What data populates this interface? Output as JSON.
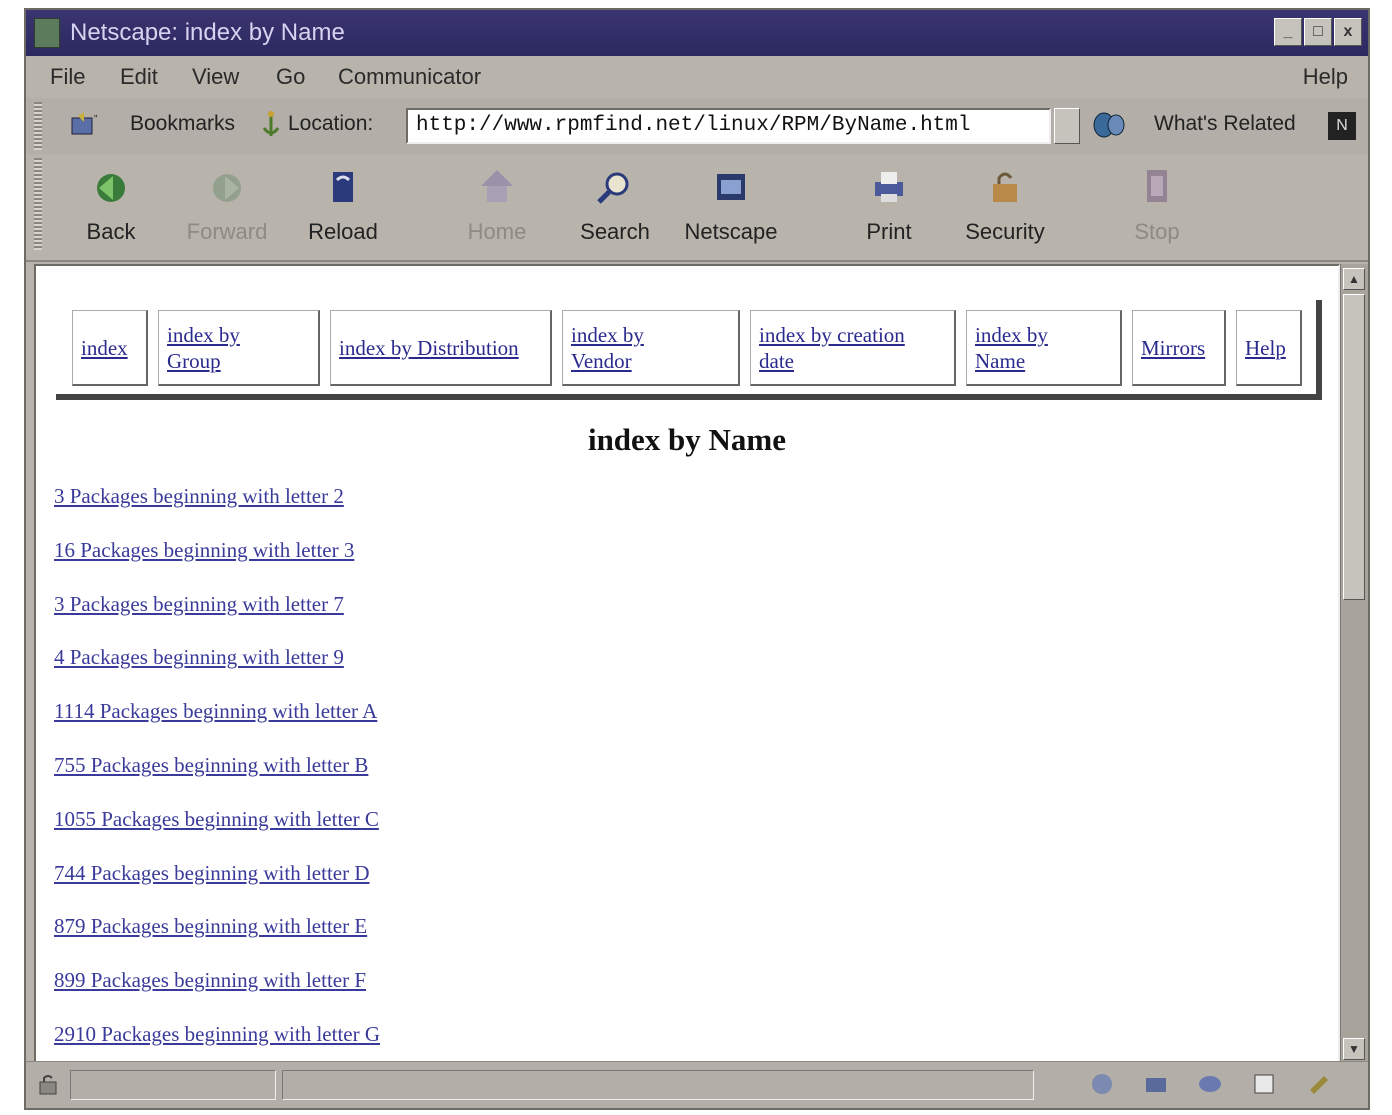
{
  "window": {
    "title": "Netscape: index by Name",
    "controls": [
      "_",
      "□",
      "x"
    ]
  },
  "menubar": {
    "items": [
      "File",
      "Edit",
      "View",
      "Go",
      "Communicator"
    ],
    "help": "Help"
  },
  "location_bar": {
    "bookmarks_label": "Bookmarks",
    "location_label": "Location:",
    "url": "http://www.rpmfind.net/linux/RPM/ByName.html",
    "whats_related_label": "What's Related",
    "netscape_button": "N"
  },
  "toolbar": {
    "buttons": [
      {
        "label": "Back",
        "icon": "back-arrow-icon",
        "enabled": true
      },
      {
        "label": "Forward",
        "icon": "forward-arrow-icon",
        "enabled": false
      },
      {
        "label": "Reload",
        "icon": "reload-icon",
        "enabled": true
      },
      {
        "label": "Home",
        "icon": "home-icon",
        "enabled": false
      },
      {
        "label": "Search",
        "icon": "search-icon",
        "enabled": true
      },
      {
        "label": "Netscape",
        "icon": "netscape-icon",
        "enabled": true
      },
      {
        "label": "Print",
        "icon": "printer-icon",
        "enabled": true
      },
      {
        "label": "Security",
        "icon": "lock-icon",
        "enabled": true
      },
      {
        "label": "Stop",
        "icon": "stop-icon",
        "enabled": false
      }
    ]
  },
  "page": {
    "nav_links": [
      "index",
      "index by Group",
      "index by Distribution",
      "index by Vendor",
      "index by creation date",
      "index by Name",
      "Mirrors",
      "Help"
    ],
    "heading": "index by Name",
    "packages": [
      "3 Packages beginning with letter 2",
      "16 Packages beginning with letter 3",
      "3 Packages beginning with letter 7",
      "4 Packages beginning with letter 9",
      "1114 Packages beginning with letter A",
      "755 Packages beginning with letter B",
      "1055 Packages beginning with letter C",
      "744 Packages beginning with letter D",
      "879 Packages beginning with letter E",
      "899 Packages beginning with letter F",
      "2910 Packages beginning with letter G"
    ]
  },
  "colors": {
    "title_bar": "#2c2860",
    "chrome": "#b8b4ac",
    "link": "#3a3a9a"
  }
}
